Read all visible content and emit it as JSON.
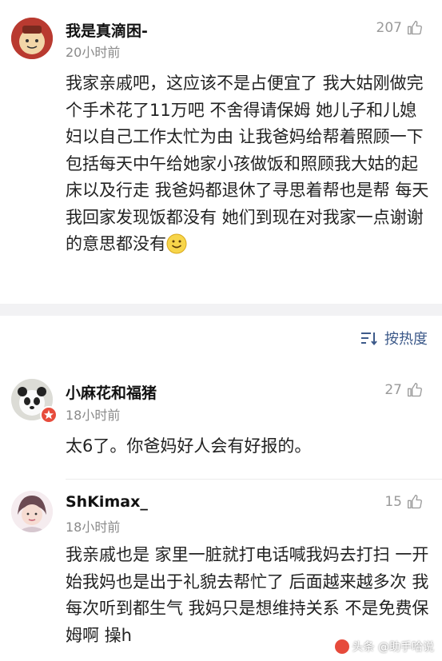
{
  "post": {
    "author": "我是真滴困-",
    "time": "20小时前",
    "likes": "207",
    "text": "我家亲戚吧，这应该不是占便宜了 我大姑刚做完个手术花了11万吧 不舍得请保姆 她儿子和儿媳妇以自己工作太忙为由 让我爸妈给帮着照顾一下 包括每天中午给她家小孩做饭和照顾我大姑的起床以及行走 我爸妈都退休了寻思着帮也是帮 每天我回家发现饭都没有 她们到现在对我家一点谢谢的意思都没有",
    "emoji": "smile-emoji"
  },
  "sort": {
    "label": "按热度",
    "icon": "sort-icon"
  },
  "comments": [
    {
      "author": "小麻花和福猪",
      "time": "18小时前",
      "likes": "27",
      "text": "太6了。你爸妈好人会有好报的。"
    },
    {
      "author": "ShKimax_",
      "time": "18小时前",
      "likes": "15",
      "text": "我亲戚也是 家里一脏就打电话喊我妈去打扫 一开始我妈也是出于礼貌去帮忙了 后面越来越多次 我每次听到都生气 我妈只是想维持关系 不是免费保姆啊 操h"
    }
  ],
  "watermark": {
    "text": "头条 @助手哈说"
  },
  "colors": {
    "accent": "#3d5a8a",
    "muted": "#8a8a8a",
    "divider": "#f2f2f4"
  }
}
